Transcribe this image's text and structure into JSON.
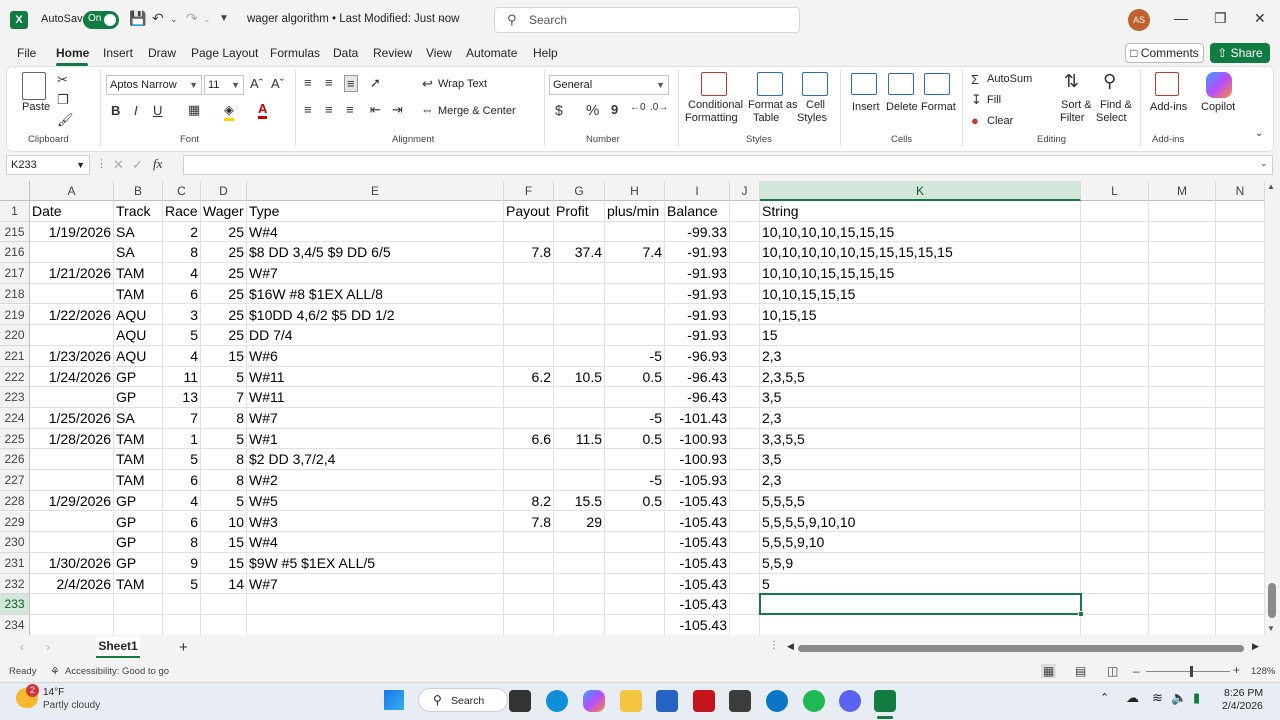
{
  "titlebar": {
    "app_badge": "X",
    "autosave_label": "AutoSave",
    "autosave_state": "On",
    "doc_title": "wager algorithm • Last Modified: Just now",
    "search_placeholder": "Search",
    "user_initials": "AS"
  },
  "menu": {
    "tabs": [
      "File",
      "Home",
      "Insert",
      "Draw",
      "Page Layout",
      "Formulas",
      "Data",
      "Review",
      "View",
      "Automate",
      "Help"
    ],
    "active": "Home",
    "comments": "Comments",
    "share": "Share"
  },
  "ribbon": {
    "paste": "Paste",
    "clipboard": "Clipboard",
    "font_name": "Aptos Narrow",
    "font_size": "11",
    "font_group": "Font",
    "bold": "B",
    "italic": "I",
    "underline": "U",
    "wrap_text": "Wrap Text",
    "merge_center": "Merge & Center",
    "alignment": "Alignment",
    "number_format": "General",
    "currency": "$",
    "percent": "%",
    "comma": "9",
    "number": "Number",
    "conditional_formatting_1": "Conditional",
    "conditional_formatting_2": "Formatting",
    "format_as_table_1": "Format as",
    "format_as_table_2": "Table",
    "cell_styles_1": "Cell",
    "cell_styles_2": "Styles",
    "styles": "Styles",
    "insert": "Insert",
    "delete": "Delete",
    "format": "Format",
    "cells": "Cells",
    "autosum": "AutoSum",
    "fill": "Fill",
    "clear": "Clear",
    "sort_filter_1": "Sort &",
    "sort_filter_2": "Filter",
    "find_select_1": "Find &",
    "find_select_2": "Select",
    "editing": "Editing",
    "addins": "Add-ins",
    "addins_group": "Add-ins",
    "copilot": "Copilot",
    "accent": "#107c41"
  },
  "formula_bar": {
    "name_box": "K233",
    "fx": "fx",
    "value": ""
  },
  "columns": [
    "A",
    "B",
    "C",
    "D",
    "E",
    "F",
    "G",
    "H",
    "I",
    "J",
    "K",
    "L",
    "M",
    "N"
  ],
  "selected_column": "K",
  "header_row": {
    "row": "1",
    "A": "Date",
    "B": "Track",
    "C": "Race",
    "D": "Wager",
    "E": "Type",
    "F": "Payout",
    "G": "Profit",
    "H": "plus/min",
    "I": "Balance",
    "J": "",
    "K": "String"
  },
  "rows": [
    {
      "row": "215",
      "A": "1/19/2026",
      "B": "SA",
      "C": "2",
      "D": "25",
      "E": "W#4",
      "F": "",
      "G": "",
      "H": "",
      "I": "-99.33",
      "K": "10,10,10,10,15,15,15"
    },
    {
      "row": "216",
      "A": "",
      "B": "SA",
      "C": "8",
      "D": "25",
      "E": "$8 DD 3,4/5  $9 DD 6/5",
      "F": "7.8",
      "G": "37.4",
      "H": "7.4",
      "I": "-91.93",
      "K": "10,10,10,10,10,15,15,15,15,15"
    },
    {
      "row": "217",
      "A": "1/21/2026",
      "B": "TAM",
      "C": "4",
      "D": "25",
      "E": "W#7",
      "F": "",
      "G": "",
      "H": "",
      "I": "-91.93",
      "K": "10,10,10,15,15,15,15"
    },
    {
      "row": "218",
      "A": "",
      "B": "TAM",
      "C": "6",
      "D": "25",
      "E": "$16W #8  $1EX ALL/8",
      "F": "",
      "G": "",
      "H": "",
      "I": "-91.93",
      "K": "10,10,15,15,15"
    },
    {
      "row": "219",
      "A": "1/22/2026",
      "B": "AQU",
      "C": "3",
      "D": "25",
      "E": "$10DD 4,6/2  $5 DD 1/2",
      "F": "",
      "G": "",
      "H": "",
      "I": "-91.93",
      "K": "10,15,15"
    },
    {
      "row": "220",
      "A": "",
      "B": "AQU",
      "C": "5",
      "D": "25",
      "E": "DD 7/4",
      "F": "",
      "G": "",
      "H": "",
      "I": "-91.93",
      "K": "15"
    },
    {
      "row": "221",
      "A": "1/23/2026",
      "B": "AQU",
      "C": "4",
      "D": "15",
      "E": "W#6",
      "F": "",
      "G": "",
      "H": "-5",
      "I": "-96.93",
      "K": "2,3"
    },
    {
      "row": "222",
      "A": "1/24/2026",
      "B": "GP",
      "C": "11",
      "D": "5",
      "E": "W#11",
      "F": "6.2",
      "G": "10.5",
      "H": "0.5",
      "I": "-96.43",
      "K": "2,3,5,5"
    },
    {
      "row": "223",
      "A": "",
      "B": "GP",
      "C": "13",
      "D": "7",
      "E": "W#11",
      "F": "",
      "G": "",
      "H": "",
      "I": "-96.43",
      "K": "3,5"
    },
    {
      "row": "224",
      "A": "1/25/2026",
      "B": "SA",
      "C": "7",
      "D": "8",
      "E": "W#7",
      "F": "",
      "G": "",
      "H": "-5",
      "I": "-101.43",
      "K": "2,3"
    },
    {
      "row": "225",
      "A": "1/28/2026",
      "B": "TAM",
      "C": "1",
      "D": "5",
      "E": "W#1",
      "F": "6.6",
      "G": "11.5",
      "H": "0.5",
      "I": "-100.93",
      "K": "3,3,5,5"
    },
    {
      "row": "226",
      "A": "",
      "B": "TAM",
      "C": "5",
      "D": "8",
      "E": "$2 DD 3,7/2,4",
      "F": "",
      "G": "",
      "H": "",
      "I": "-100.93",
      "K": "3,5"
    },
    {
      "row": "227",
      "A": "",
      "B": "TAM",
      "C": "6",
      "D": "8",
      "E": "W#2",
      "F": "",
      "G": "",
      "H": "-5",
      "I": "-105.93",
      "K": "2,3"
    },
    {
      "row": "228",
      "A": "1/29/2026",
      "B": "GP",
      "C": "4",
      "D": "5",
      "E": "W#5",
      "F": "8.2",
      "G": "15.5",
      "H": "0.5",
      "I": "-105.43",
      "K": "5,5,5,5"
    },
    {
      "row": "229",
      "A": "",
      "B": "GP",
      "C": "6",
      "D": "10",
      "E": "W#3",
      "F": "7.8",
      "G": "29",
      "H": "",
      "I": "-105.43",
      "K": "5,5,5,5,9,10,10"
    },
    {
      "row": "230",
      "A": "",
      "B": "GP",
      "C": "8",
      "D": "15",
      "E": "W#4",
      "F": "",
      "G": "",
      "H": "",
      "I": "-105.43",
      "K": "5,5,5,9,10"
    },
    {
      "row": "231",
      "A": "1/30/2026",
      "B": "GP",
      "C": "9",
      "D": "15",
      "E": "$9W #5  $1EX ALL/5",
      "F": "",
      "G": "",
      "H": "",
      "I": "-105.43",
      "K": "5,5,9"
    },
    {
      "row": "232",
      "A": "2/4/2026",
      "B": "TAM",
      "C": "5",
      "D": "14",
      "E": "W#7",
      "F": "",
      "G": "",
      "H": "",
      "I": "-105.43",
      "K": "5"
    },
    {
      "row": "233",
      "A": "",
      "B": "",
      "C": "",
      "D": "",
      "E": "",
      "F": "",
      "G": "",
      "H": "",
      "I": "-105.43",
      "K": ""
    },
    {
      "row": "234",
      "A": "",
      "B": "",
      "C": "",
      "D": "",
      "E": "",
      "F": "",
      "G": "",
      "H": "",
      "I": "-105.43",
      "K": ""
    }
  ],
  "selected_row": "233",
  "sheets": [
    "Sheet1"
  ],
  "active_sheet": "Sheet1",
  "status": {
    "ready": "Ready",
    "accessibility": "Accessibility: Good to go",
    "zoom": "128%"
  },
  "taskbar": {
    "weather_temp": "14°F",
    "weather_desc": "Partly cloudy",
    "weather_badge": "2",
    "search": "Search",
    "time": "8:26 PM",
    "date": "2/4/2026"
  }
}
